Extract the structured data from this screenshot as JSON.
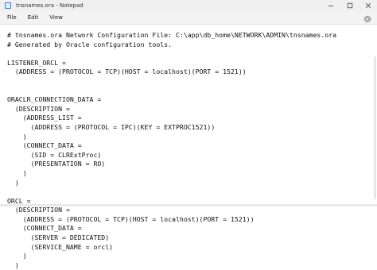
{
  "window": {
    "title": "tnsnames.ora - Notepad"
  },
  "menu": {
    "items": [
      "File",
      "Edit",
      "View"
    ]
  },
  "editor": {
    "lines": [
      "# tnsnames.ora Network Configuration File: C:\\app\\db_home\\NETWORK\\ADMIN\\tnsnames.ora",
      "# Generated by Oracle configuration tools.",
      "",
      "LISTENER_ORCL =",
      "  (ADDRESS = (PROTOCOL = TCP)(HOST = localhost)(PORT = 1521))",
      "",
      "",
      "ORACLR_CONNECTION_DATA =",
      "  (DESCRIPTION =",
      "    (ADDRESS_LIST =",
      "      (ADDRESS = (PROTOCOL = IPC)(KEY = EXTPROC1521))",
      "    )",
      "    (CONNECT_DATA =",
      "      (SID = CLRExtProc)",
      "      (PRESENTATION = RO)",
      "    )",
      "  )",
      "",
      "ORCL =",
      "  (DESCRIPTION =",
      "    (ADDRESS = (PROTOCOL = TCP)(HOST = localhost)(PORT = 1521))",
      "    (CONNECT_DATA =",
      "      (SERVER = DEDICATED)",
      "      (SERVICE_NAME = orcl)",
      "    )",
      "  )"
    ]
  },
  "icons": {
    "app": "notepad-icon",
    "minimize": "minimize-icon",
    "maximize": "maximize-icon",
    "close": "close-icon",
    "settings": "gear-icon"
  }
}
